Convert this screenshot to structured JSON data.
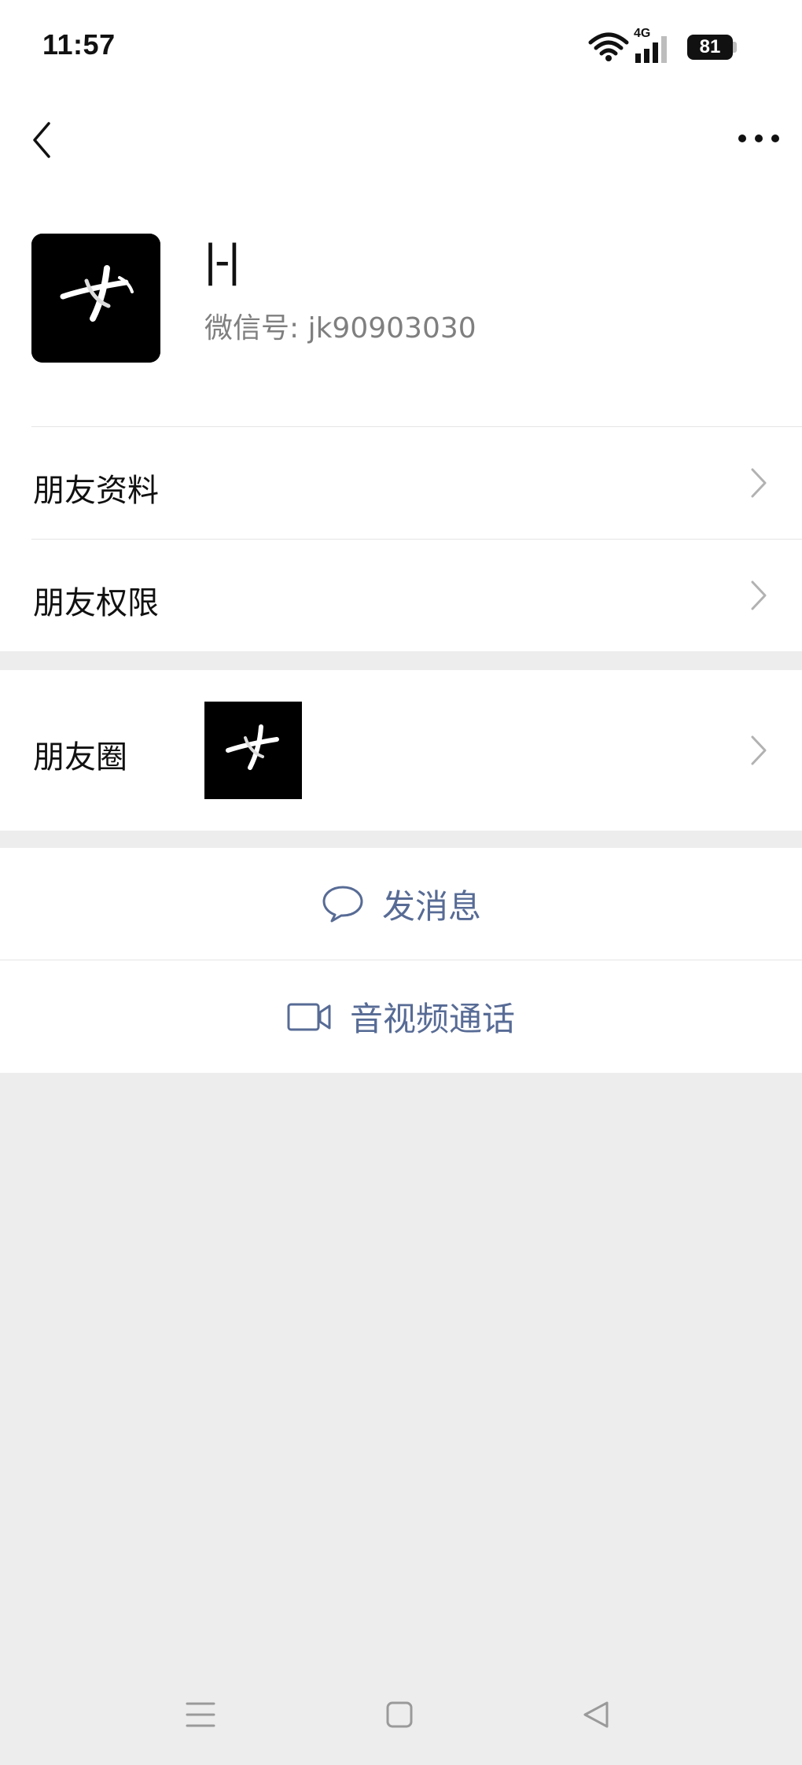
{
  "status_bar": {
    "time": "11:57",
    "network": "4G",
    "battery": "81"
  },
  "profile": {
    "name": "|-|",
    "wechat_id": "微信号: jk90903030"
  },
  "rows": {
    "friend_info": "朋友资料",
    "friend_permissions": "朋友权限",
    "moments": "朋友圈"
  },
  "actions": {
    "send_message": "发消息",
    "video_call": "音视频通话"
  },
  "colors": {
    "link_blue": "#576B95",
    "background": "#EDEDED"
  }
}
